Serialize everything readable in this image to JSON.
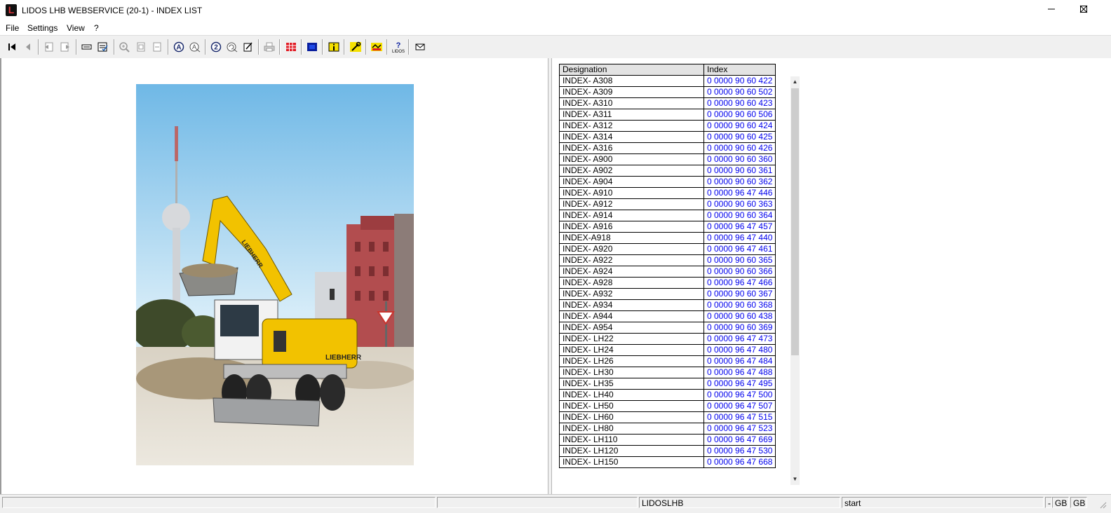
{
  "window": {
    "title": "LIDOS LHB WEBSERVICE (20-1) - INDEX LIST",
    "logo_letter": "L"
  },
  "menu": [
    {
      "label": "File"
    },
    {
      "label": "Settings"
    },
    {
      "label": "View"
    },
    {
      "label": "?"
    }
  ],
  "toolbar": {
    "icons": [
      "first-page-icon",
      "previous-page-icon",
      "back-document-icon",
      "forward-document-icon",
      "parts-list-icon",
      "checklist-icon",
      "zoom-in-icon",
      "page-fit-icon",
      "page-width-icon",
      "annotation-icon",
      "annotation-off-icon",
      "search-number-icon",
      "search-refresh-icon",
      "edit-icon",
      "print-icon",
      "grid-view-icon",
      "blue-square-icon",
      "info-icon",
      "tools-icon",
      "handshake-icon",
      "lidos-help-icon",
      "mail-icon"
    ]
  },
  "photo": {
    "brand_text": "LIEBHERR"
  },
  "table": {
    "headers": {
      "designation": "Designation",
      "index": "Index"
    },
    "rows": [
      {
        "designation": "INDEX- A308",
        "index": "0 0000 90 60 422"
      },
      {
        "designation": "INDEX- A309",
        "index": "0 0000 90 60 502"
      },
      {
        "designation": "INDEX- A310",
        "index": "0 0000 90 60 423"
      },
      {
        "designation": "INDEX- A311",
        "index": "0 0000 90 60 506"
      },
      {
        "designation": "INDEX- A312",
        "index": "0 0000 90 60 424"
      },
      {
        "designation": "INDEX- A314",
        "index": "0 0000 90 60 425"
      },
      {
        "designation": "INDEX- A316",
        "index": "0 0000 90 60 426"
      },
      {
        "designation": "INDEX- A900",
        "index": "0 0000 90 60 360"
      },
      {
        "designation": "INDEX- A902",
        "index": "0 0000 90 60 361"
      },
      {
        "designation": "INDEX- A904",
        "index": "0 0000 90 60 362"
      },
      {
        "designation": "INDEX- A910",
        "index": "0 0000 96 47 446"
      },
      {
        "designation": "INDEX- A912",
        "index": "0 0000 90 60 363"
      },
      {
        "designation": "INDEX- A914",
        "index": "0 0000 90 60 364"
      },
      {
        "designation": "INDEX- A916",
        "index": "0 0000 96 47 457"
      },
      {
        "designation": "INDEX-A918",
        "index": "0 0000 96 47 440"
      },
      {
        "designation": "INDEX- A920",
        "index": "0 0000 96 47 461"
      },
      {
        "designation": "INDEX- A922",
        "index": "0 0000 90 60 365"
      },
      {
        "designation": "INDEX- A924",
        "index": "0 0000 90 60 366"
      },
      {
        "designation": "INDEX- A928",
        "index": "0 0000 96 47 466"
      },
      {
        "designation": "INDEX- A932",
        "index": "0 0000 90 60 367"
      },
      {
        "designation": "INDEX- A934",
        "index": "0 0000 90 60 368"
      },
      {
        "designation": "INDEX- A944",
        "index": "0 0000 90 60 438"
      },
      {
        "designation": "INDEX- A954",
        "index": "0 0000 90 60 369"
      },
      {
        "designation": "INDEX- LH22",
        "index": "0 0000 96 47 473"
      },
      {
        "designation": "INDEX- LH24",
        "index": "0 0000 96 47 480"
      },
      {
        "designation": "INDEX- LH26",
        "index": "0 0000 96 47 484"
      },
      {
        "designation": "INDEX- LH30",
        "index": "0 0000 96 47 488"
      },
      {
        "designation": "INDEX- LH35",
        "index": "0 0000 96 47 495"
      },
      {
        "designation": "INDEX- LH40",
        "index": "0 0000 96 47 500"
      },
      {
        "designation": "INDEX- LH50",
        "index": "0 0000 96 47 507"
      },
      {
        "designation": "INDEX- LH60",
        "index": "0 0000 96 47 515"
      },
      {
        "designation": "INDEX- LH80",
        "index": "0 0000 96 47 523"
      },
      {
        "designation": "INDEX- LH110",
        "index": "0 0000 96 47 669"
      },
      {
        "designation": "INDEX- LH120",
        "index": "0 0000 96 47 530"
      },
      {
        "designation": "INDEX- LH150",
        "index": "0 0000 96 47 668"
      }
    ]
  },
  "statusbar": {
    "panel_1": "",
    "panel_2": "",
    "panel_3": "LIDOSLHB",
    "panel_4": "start",
    "panel_5": "-",
    "panel_6": "GB",
    "panel_7": "GB"
  },
  "colors": {
    "link": "#0000ee",
    "machine_yellow": "#f2c200",
    "sky": "#8fc9ea"
  }
}
